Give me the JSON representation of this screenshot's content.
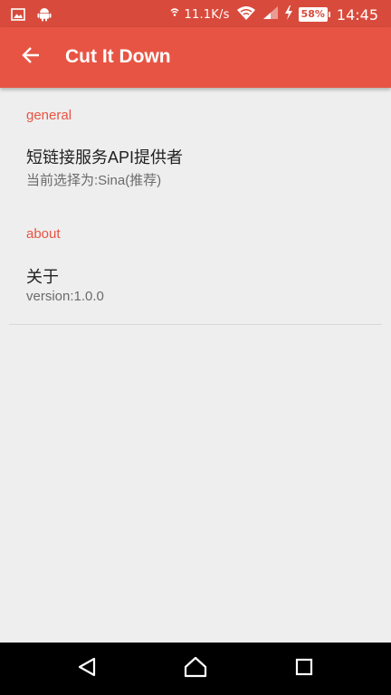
{
  "status_bar": {
    "network_speed": "11.1K/s",
    "battery_percent": "58%",
    "time": "14:45",
    "icons": [
      "image-icon",
      "android-icon",
      "wifi-icon",
      "signal-icon",
      "charging-icon",
      "battery-icon"
    ]
  },
  "app_bar": {
    "title": "Cut It Down",
    "back_icon": "arrow-left-icon"
  },
  "preferences": {
    "general": {
      "header": "general",
      "items": [
        {
          "title": "短链接服务API提供者",
          "summary": "当前选择为:Sina(推荐)"
        }
      ]
    },
    "about": {
      "header": "about",
      "items": [
        {
          "title": "关于",
          "summary": "version:1.0.0"
        }
      ]
    }
  },
  "nav_bar": {
    "icons": [
      "back-triangle-icon",
      "home-icon",
      "recents-icon"
    ]
  },
  "colors": {
    "status_bar": "#d84b3c",
    "app_bar": "#e85444",
    "accent": "#e85444",
    "background": "#eeeeee"
  }
}
